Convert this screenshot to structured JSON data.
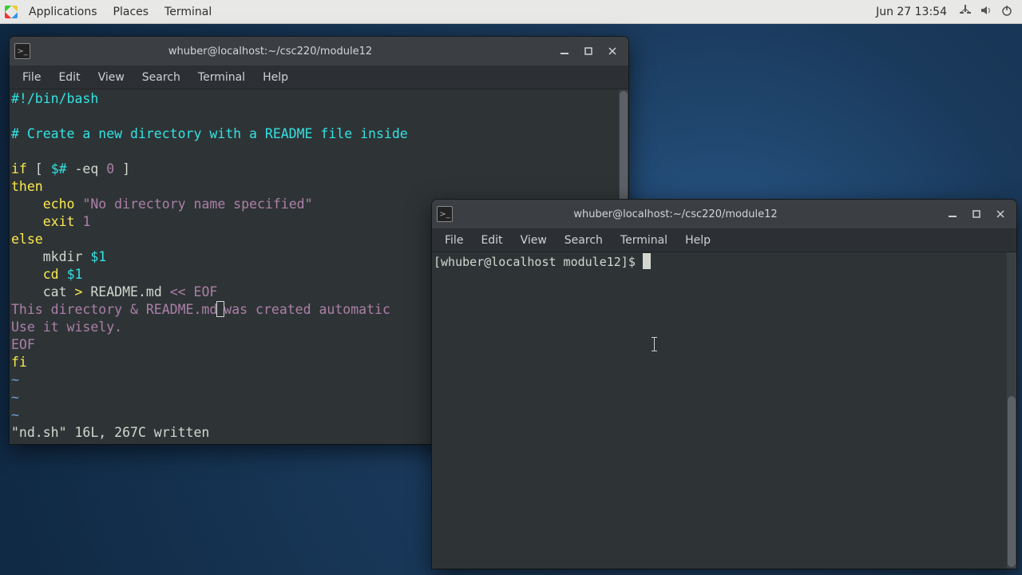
{
  "panel": {
    "applications": "Applications",
    "places": "Places",
    "terminal": "Terminal",
    "clock": "Jun 27  13:54"
  },
  "menus": {
    "file": "File",
    "edit": "Edit",
    "view": "View",
    "search": "Search",
    "terminal": "Terminal",
    "help": "Help"
  },
  "win1": {
    "title": "whuber@localhost:~/csc220/module12",
    "code": {
      "l1": "#!/bin/bash",
      "l2": "",
      "l3": "# Create a new directory with a README file inside",
      "l4": "",
      "l5a": "if",
      "l5b": " [ ",
      "l5c": "$#",
      "l5d": " -eq ",
      "l5e": "0",
      "l5f": " ]",
      "l6": "then",
      "l7a": "    ",
      "l7b": "echo",
      "l7c": " ",
      "l7d": "\"No directory name specified\"",
      "l8a": "    ",
      "l8b": "exit",
      "l8c": " ",
      "l8d": "1",
      "l9": "else",
      "l10a": "    mkdir ",
      "l10b": "$1",
      "l11a": "    ",
      "l11b": "cd",
      "l11c": " ",
      "l11d": "$1",
      "l12a": "    cat ",
      "l12b": ">",
      "l12c": " README.md ",
      "l12d": "<< EOF",
      "l13a": "This directory & README.md",
      "l13b": "was created automatic",
      "l14": "Use it wisely.",
      "l15": "EOF",
      "l16": "fi",
      "tilde": "~",
      "status": "\"nd.sh\" 16L, 267C written"
    }
  },
  "win2": {
    "title": "whuber@localhost:~/csc220/module12",
    "prompt": "[whuber@localhost module12]$ "
  }
}
